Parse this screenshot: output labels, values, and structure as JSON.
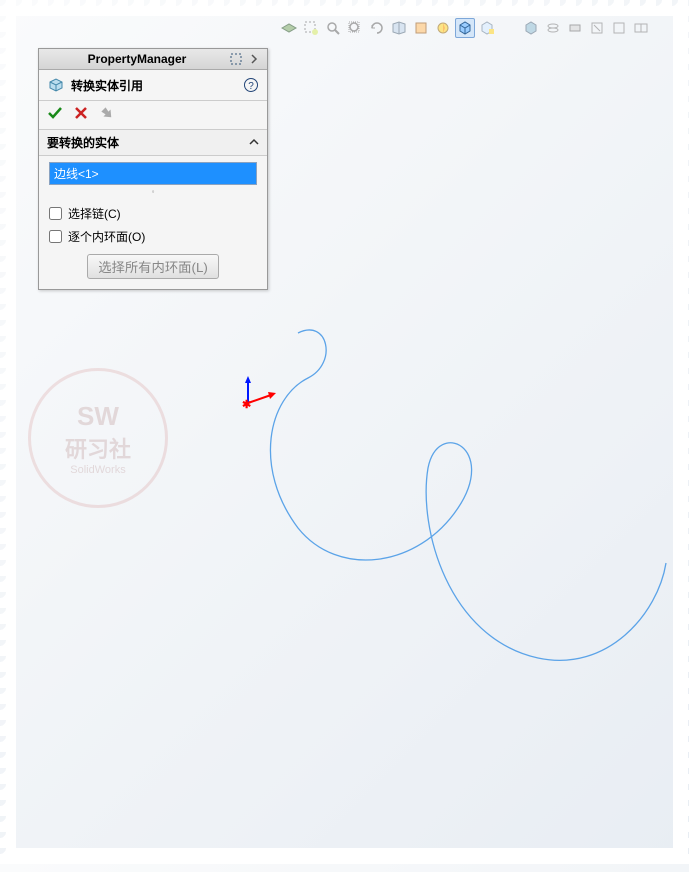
{
  "toolbar": {
    "icons": [
      "plane-icon",
      "box-select-icon",
      "zoom-icon",
      "zoom-fit-icon",
      "rotate-icon",
      "section-icon",
      "display-style-icon",
      "appearance-icon",
      "cube-icon",
      "cube2-icon",
      "book-icon",
      "tool-icon",
      "wire-icon",
      "shade-icon",
      "view1-icon",
      "view2-icon",
      "view3-icon"
    ],
    "activeIndex": 8
  },
  "panel": {
    "header": "PropertyManager",
    "command_title": "转换实体引用",
    "ok_label": "OK",
    "cancel_label": "Cancel",
    "section_header": "要转换的实体",
    "selection_items": [
      "边线<1>"
    ],
    "checkbox_chain": "选择链(C)",
    "checkbox_inner": "逐个内环面(O)",
    "button_select_all": "选择所有内环面(L)"
  },
  "watermark": {
    "line1": "SW",
    "line2": "研习社",
    "line3": "SolidWorks"
  }
}
